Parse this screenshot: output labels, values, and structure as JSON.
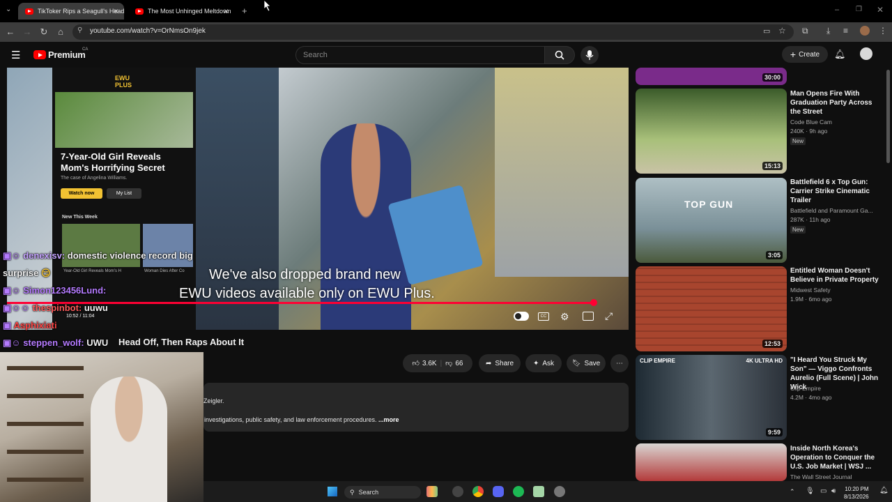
{
  "browser": {
    "tabs": [
      {
        "title": "TikToker Rips a Seagull's Head Of"
      },
      {
        "title": "The Most Unhinged Meltdown"
      }
    ],
    "url": "youtube.com/watch?v=OrNmsOn9jek"
  },
  "youtube": {
    "logo_text": "Premium",
    "region": "CA",
    "search_placeholder": "Search",
    "create_label": "Create"
  },
  "video": {
    "subtitle_line1": "We've also dropped brand new",
    "subtitle_line2": "EWU videos available only on EWU Plus.",
    "progress": 0.97,
    "phone": {
      "brand": "EWU\nPLUS",
      "headline": "7-Year-Old Girl Reveals Mom's Horrifying Secret",
      "subhead": "The case of Angelina Williams.",
      "watch_now": "Watch now",
      "my_list": "My List",
      "new_this_week": "New This Week",
      "thumb_caption_1": "Year-Old Girl Reveals Mom's H",
      "thumb_caption_2": "Woman Dies After Co",
      "time": "10:52 / 11:04"
    }
  },
  "chat": [
    {
      "user": "denexisv:",
      "msg": "domestic violence record big",
      "color": "#c5a3ff"
    },
    {
      "user": "",
      "msg": "surprise",
      "color": "#ffffff"
    },
    {
      "user": "Simon123456Lund:",
      "msg": "",
      "color": "#b57bff"
    },
    {
      "user": "thespinbot:",
      "msg": "uuwu",
      "color": "#ff5a5a"
    },
    {
      "user": "Asphixiati",
      "msg": "",
      "color": "#ff4444"
    },
    {
      "user": "steppen_wolf:",
      "msg": "UWU",
      "color": "#b57bff"
    }
  ],
  "title_partial": "Head Off, Then Raps About It",
  "actions": {
    "likes": "3.6K",
    "dislikes": "66",
    "share": "Share",
    "ask": "Ask",
    "save": "Save"
  },
  "description": {
    "line1": "Zeigler.",
    "line2": "investigations, public safety, and law enforcement procedures.",
    "more": "...more"
  },
  "sidebar": [
    {
      "title": "",
      "channel": "",
      "meta": "",
      "duration": "30:00",
      "badge": "",
      "thumb_color": "#7a2b8a"
    },
    {
      "title": "Man Opens Fire With Graduation Party Across the Street",
      "channel": "Code Blue Cam",
      "meta": "240K · 9h ago",
      "duration": "15:13",
      "badge": "New",
      "thumb_color": "#6a8c4a"
    },
    {
      "title": "Battlefield 6 x Top Gun: Carrier Strike Cinematic Trailer",
      "channel": "Battlefield and Paramount Ga...",
      "meta": "287K · 11h ago",
      "duration": "3:05",
      "badge": "New",
      "thumb_color": "#9fb3b8"
    },
    {
      "title": "Entitled Woman Doesn't Believe in Private Property",
      "channel": "Midwest Safety",
      "meta": "1.9M · 6mo ago",
      "duration": "12:53",
      "badge": "",
      "thumb_color": "#a8452e"
    },
    {
      "title": "\"I Heard You Struck My Son\" — Viggo Confronts Aurelio (Full Scene) | John Wick",
      "channel": "Clip Empire",
      "meta": "4.2M · 4mo ago",
      "duration": "9:59",
      "badge": "",
      "thumb_color": "#3f4b55"
    },
    {
      "title": "Inside North Korea's Operation to Conquer the U.S. Job Market | WSJ ...",
      "channel": "The Wall Street Journal",
      "meta": "",
      "duration": "",
      "badge": "",
      "thumb_color": "#c9c5c2"
    }
  ],
  "taskbar": {
    "search": "Search",
    "time": "10:20 PM",
    "date": "8/13/2026"
  }
}
